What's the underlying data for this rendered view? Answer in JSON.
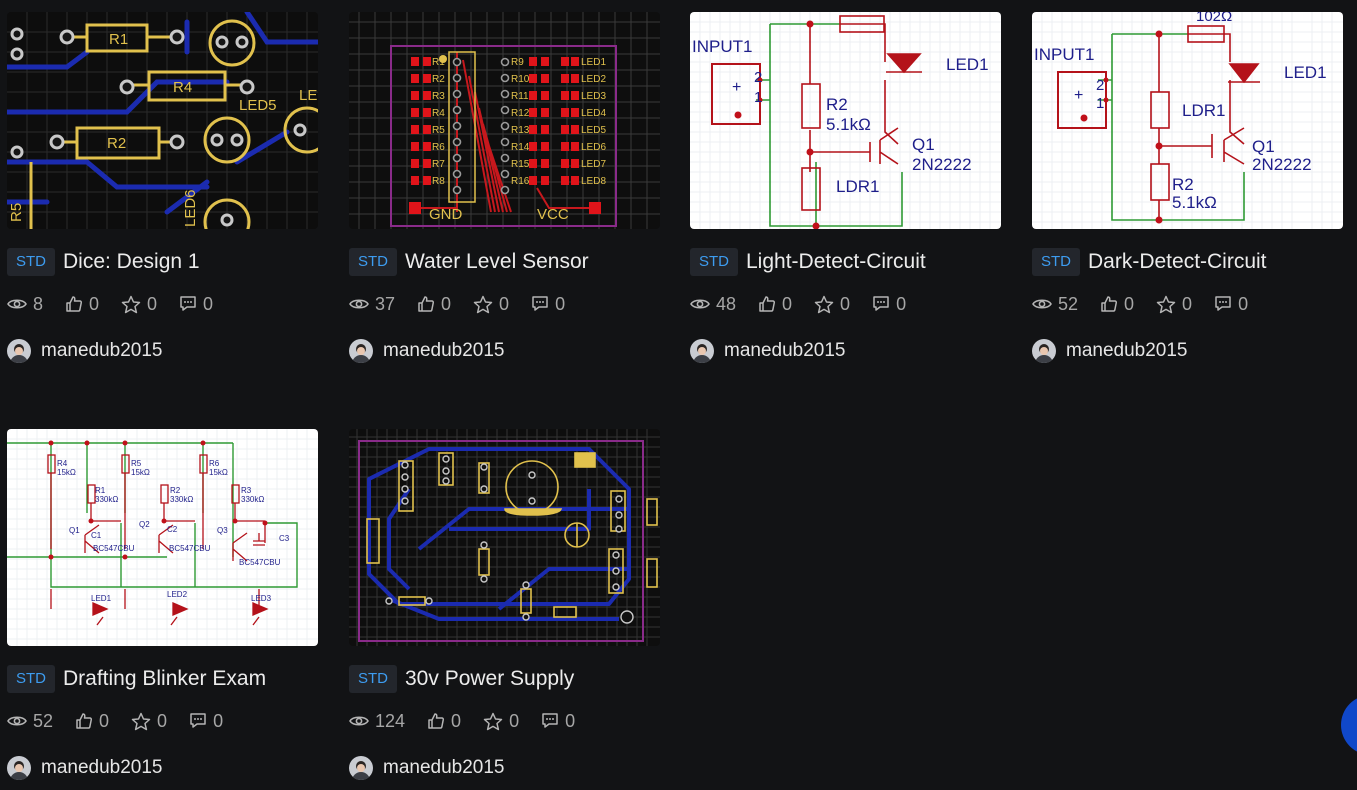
{
  "projects": [
    {
      "badge": "STD",
      "title": "Dice: Design 1",
      "views": "8",
      "likes": "0",
      "stars": "0",
      "comments": "0",
      "author": "manedub2015"
    },
    {
      "badge": "STD",
      "title": "Water Level Sensor",
      "views": "37",
      "likes": "0",
      "stars": "0",
      "comments": "0",
      "author": "manedub2015"
    },
    {
      "badge": "STD",
      "title": "Light-Detect-Circuit",
      "views": "48",
      "likes": "0",
      "stars": "0",
      "comments": "0",
      "author": "manedub2015"
    },
    {
      "badge": "STD",
      "title": "Dark-Detect-Circuit",
      "views": "52",
      "likes": "0",
      "stars": "0",
      "comments": "0",
      "author": "manedub2015"
    },
    {
      "badge": "STD",
      "title": "Drafting Blinker Exam",
      "views": "52",
      "likes": "0",
      "stars": "0",
      "comments": "0",
      "author": "manedub2015"
    },
    {
      "badge": "STD",
      "title": "30v Power Supply",
      "views": "124",
      "likes": "0",
      "stars": "0",
      "comments": "0",
      "author": "manedub2015"
    }
  ],
  "thumb_text": {
    "dice": {
      "r1": "R1",
      "r4": "R4",
      "r2": "R2",
      "r5": "R5",
      "led5": "LED5",
      "led6": "LED6",
      "le": "LE"
    },
    "water": {
      "gnd": "GND",
      "vcc": "VCC",
      "left": [
        "R1",
        "R2",
        "R3",
        "R4",
        "R5",
        "R6",
        "R7",
        "R8"
      ],
      "mid": [
        "R9",
        "R10",
        "R11",
        "R12",
        "R13",
        "R14",
        "R15",
        "R16"
      ],
      "right": [
        "LED1",
        "LED2",
        "LED3",
        "LED4",
        "LED5",
        "LED6",
        "LED7",
        "LED8"
      ]
    },
    "light": {
      "input": "INPUT1",
      "pin2": "2",
      "pin1": "1",
      "r2": "R2",
      "r2v": "5.1kΩ",
      "ldr": "LDR1",
      "led": "LED1",
      "q1": "Q1",
      "q1t": "2N2222"
    },
    "dark": {
      "top": "102Ω",
      "input": "INPUT1",
      "pin2": "2",
      "pin1": "1",
      "ldr": "LDR1",
      "led": "LED1",
      "q1": "Q1",
      "q1t": "2N2222",
      "r2": "R2",
      "r2v": "5.1kΩ"
    },
    "blinker": {
      "r4": "R4",
      "r4v": "15kΩ",
      "r5": "R5",
      "r5v": "15kΩ",
      "r6": "R6",
      "r6v": "15kΩ",
      "r1": "R1",
      "r1v": "330kΩ",
      "r2": "R2",
      "r2v": "330kΩ",
      "r3": "R3",
      "r3v": "330kΩ",
      "q1": "Q1",
      "q2": "Q2",
      "q3": "Q3",
      "c1": "C1",
      "c2": "C2",
      "c3": "C3",
      "bc": "BC547CBU",
      "led1": "LED1",
      "led2": "LED2",
      "led3": "LED3"
    }
  },
  "colors": {
    "background": "#121315",
    "badge_text": "#3d9cf0",
    "badge_bg": "#23262c",
    "fab": "#1048c9"
  }
}
